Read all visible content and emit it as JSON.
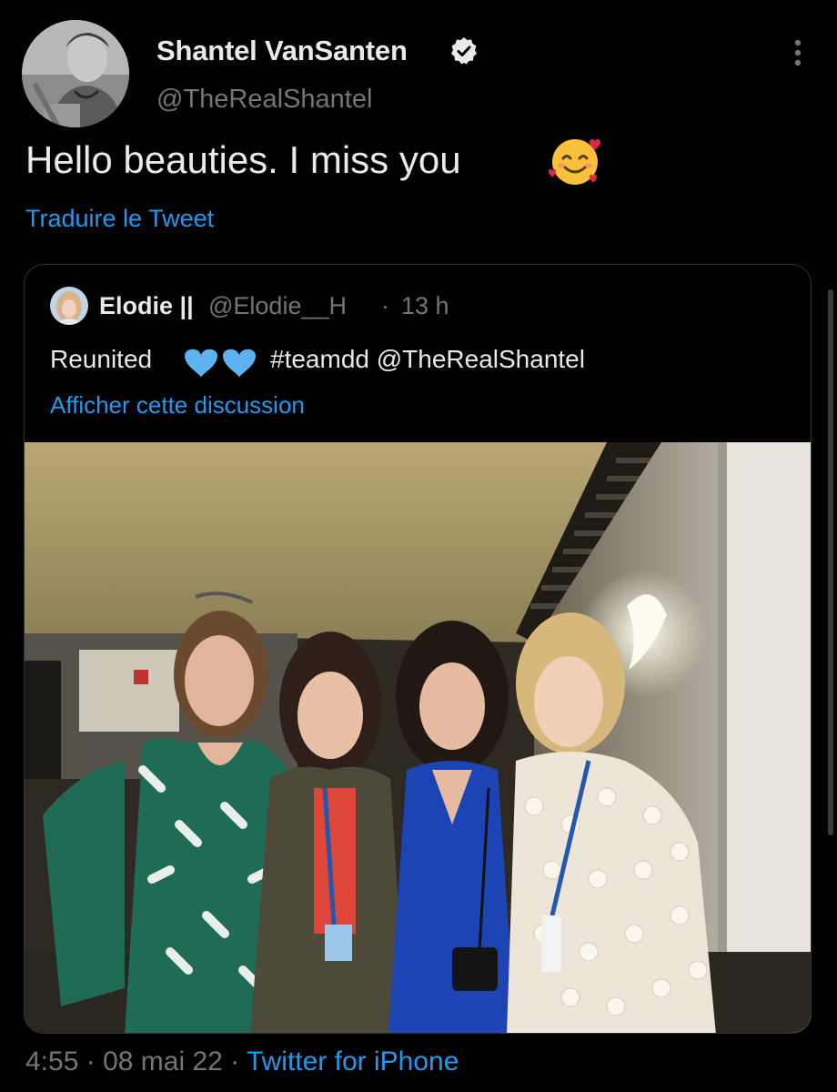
{
  "tweet": {
    "author": {
      "display_name": "Shantel VanSanten",
      "handle": "@TheRealShantel",
      "verified": true,
      "avatar_icon": "profile-photo"
    },
    "text": "Hello beauties. I miss you",
    "emoji": "smiling-face-with-hearts",
    "translate_label": "Traduire le Tweet",
    "more_icon": "vertical-ellipsis-icon"
  },
  "quoted_tweet": {
    "display_name": "Elodie ||",
    "handle": "@Elodie__H",
    "separator": "·",
    "time": "13 h",
    "text_start": "Reunited",
    "hearts": "two-blue-hearts",
    "text_end": "#teamdd @TheRealShantel",
    "thread_link": "Afficher cette discussion",
    "photo": "group-photo-four-women"
  },
  "meta": {
    "time": "4:55",
    "separator1": " · ",
    "date": "08 mai 22",
    "separator2": " · ",
    "source": "Twitter for iPhone"
  },
  "colors": {
    "background": "#000000",
    "text": "#e7e9ea",
    "secondary": "#71767b",
    "link": "#1d9bf0",
    "border": "#2f3336",
    "heart_blue": "#5db3f0"
  }
}
